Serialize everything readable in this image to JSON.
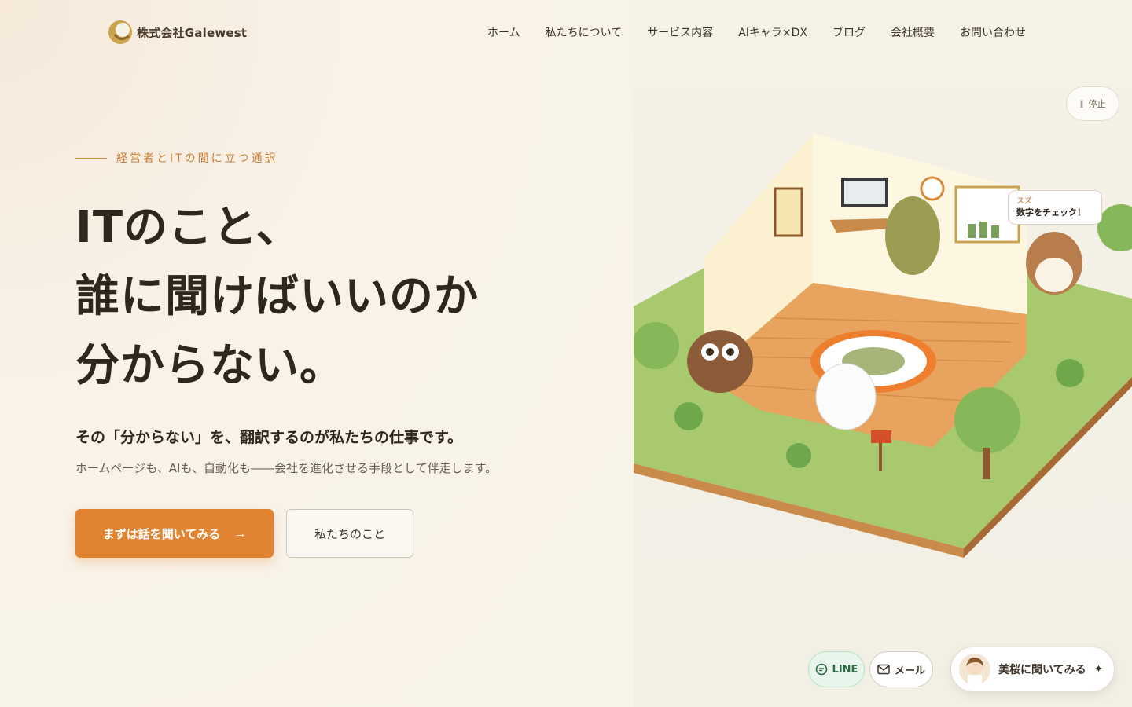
{
  "header": {
    "logo_text": "株式会社Galewest",
    "nav": [
      "ホーム",
      "私たちについて",
      "サービス内容",
      "AIキャラ×DX",
      "ブログ",
      "会社概要",
      "お問い合わせ"
    ]
  },
  "animation": {
    "stop_label": "停止",
    "stop_icon": "pause-icon"
  },
  "hero": {
    "eyebrow": "経営者とITの間に立つ通訳",
    "headline": [
      "ITのこと、",
      "誰に聞けばいいのか",
      "分からない。"
    ],
    "lead": "その「分からない」を、翻訳するのが私たちの仕事です。",
    "sub": "ホームページも、AIも、自動化も――会社を進化させる手段として伴走します。",
    "cta_primary": "まずは話を聞いてみる",
    "cta_primary_icon": "arrow-right-icon",
    "cta_secondary": "私たちのこと"
  },
  "illustration": {
    "speech_bubble": {
      "name": "スズ",
      "message": "数字をチェック！"
    }
  },
  "contact": {
    "line_label": "LINE",
    "mail_label": "メール",
    "ask_label": "美桜に聞いてみる",
    "ask_icon": "sparkle-icon"
  },
  "colors": {
    "accent": "#e08432",
    "eyebrow": "#c97f34",
    "highlight": "#f2c9a0",
    "line_green": "#2c6b45"
  }
}
